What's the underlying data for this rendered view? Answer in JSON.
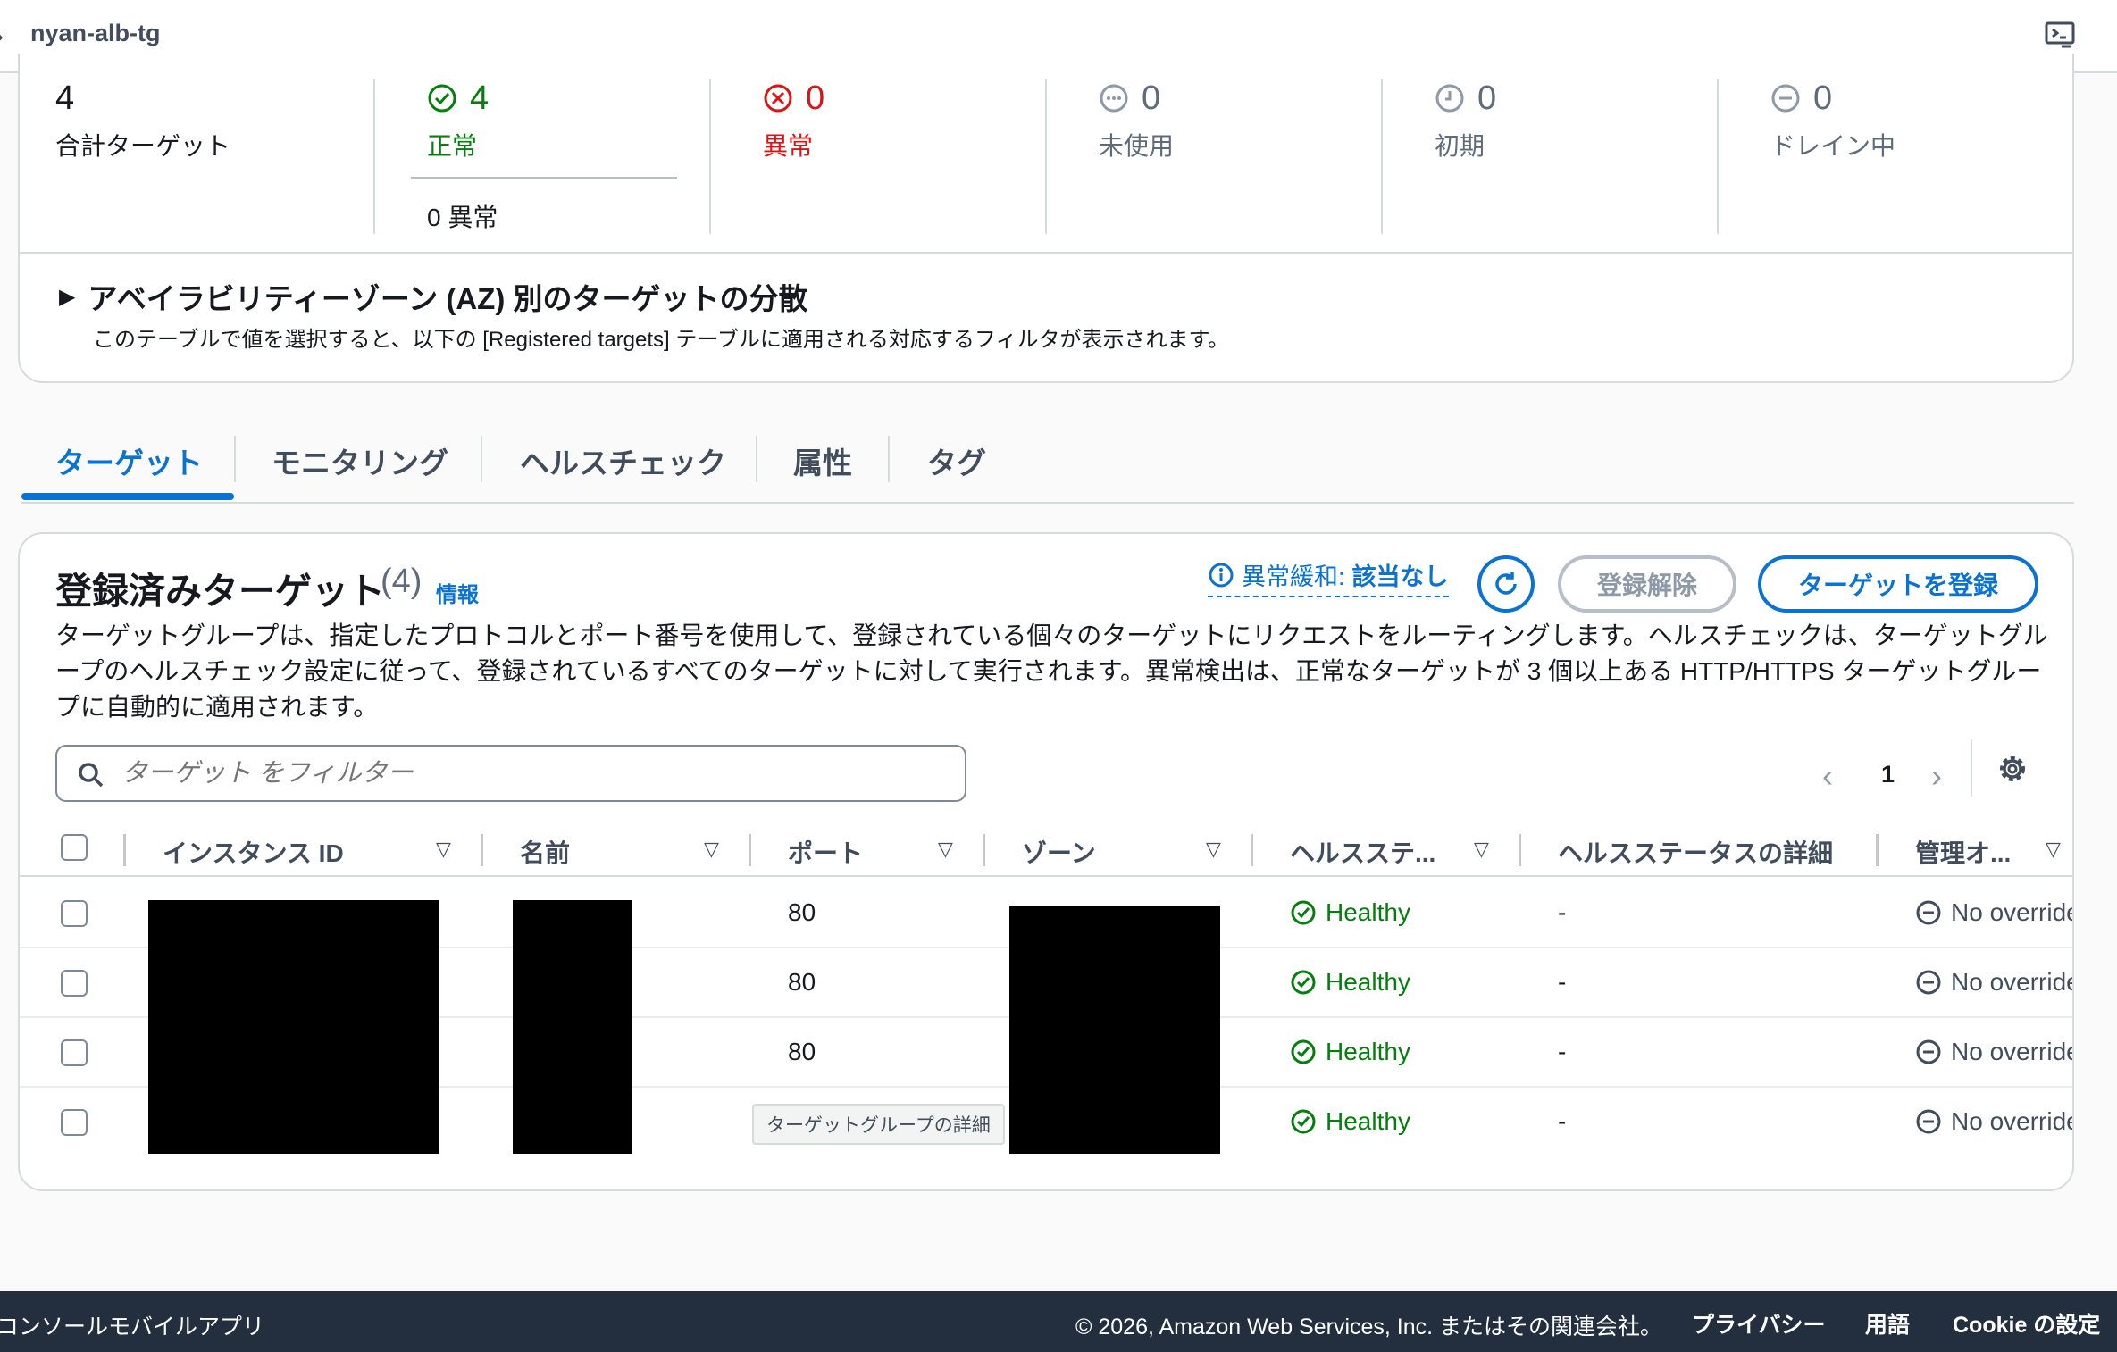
{
  "breadcrumb": {
    "current": "nyan-alb-tg"
  },
  "summary": {
    "total": {
      "value": "4",
      "label": "合計ターゲット"
    },
    "healthy": {
      "value": "4",
      "label": "正常",
      "sub": "0 異常"
    },
    "unhealthy": {
      "value": "0",
      "label": "異常"
    },
    "unused": {
      "value": "0",
      "label": "未使用"
    },
    "initial": {
      "value": "0",
      "label": "初期"
    },
    "draining": {
      "value": "0",
      "label": "ドレイン中"
    },
    "az_title": "アベイラビリティーゾーン (AZ) 別のターゲットの分散",
    "az_desc": "このテーブルで値を選択すると、以下の [Registered targets] テーブルに適用される対応するフィルタが表示されます。"
  },
  "tabs": [
    "ターゲット",
    "モニタリング",
    "ヘルスチェック",
    "属性",
    "タグ"
  ],
  "targets": {
    "title": "登録済みターゲット",
    "count": "(4)",
    "info": "情報",
    "anomaly_label": "異常緩和:",
    "anomaly_value": "該当なし",
    "deregister": "登録解除",
    "register": "ターゲットを登録",
    "description": "ターゲットグループは、指定したプロトコルとポート番号を使用して、登録されている個々のターゲットにリクエストをルーティングします。ヘルスチェックは、ターゲットグループのヘルスチェック設定に従って、登録されているすべてのターゲットに対して実行されます。異常検出は、正常なターゲットが 3 個以上ある HTTP/HTTPS ターゲットグループに自動的に適用されます。",
    "filter_placeholder": "ターゲット をフィルター",
    "page": "1",
    "columns": [
      "インスタンス ID",
      "名前",
      "ポート",
      "ゾーン",
      "ヘルスステ...",
      "ヘルスステータスの詳細",
      "管理オ..."
    ],
    "rows": [
      {
        "port": "80",
        "health": "Healthy",
        "detail": "-",
        "admin": "No override"
      },
      {
        "port": "80",
        "health": "Healthy",
        "detail": "-",
        "admin": "No override"
      },
      {
        "port": "80",
        "health": "Healthy",
        "detail": "-",
        "admin": "No override"
      },
      {
        "port": "",
        "health": "Healthy",
        "detail": "-",
        "admin": "No override"
      }
    ],
    "tooltip": "ターゲットグループの詳細"
  },
  "footer": {
    "left": "コンソールモバイルアプリ",
    "copyright": "© 2026, Amazon Web Services, Inc. またはその関連会社。",
    "privacy": "プライバシー",
    "terms": "用語",
    "cookie": "Cookie の設定"
  },
  "colors": {
    "accent": "#0972d3",
    "healthy": "#037f0c",
    "error": "#d91515",
    "footer_bg": "#232f3e"
  }
}
